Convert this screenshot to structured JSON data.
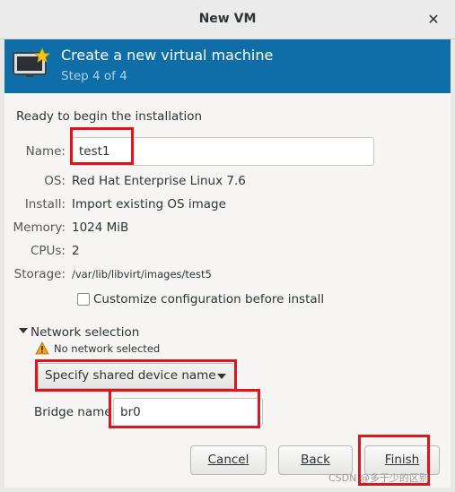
{
  "window": {
    "title": "New VM",
    "close_glyph": "✕"
  },
  "header": {
    "title": "Create a new virtual machine",
    "step": "Step 4 of 4",
    "icon": "monitor-star-icon"
  },
  "ready_text": "Ready to begin the installation",
  "fields": {
    "name": {
      "label": "Name:",
      "value": "test1"
    },
    "os": {
      "label": "OS:",
      "value": "Red Hat Enterprise Linux 7.6"
    },
    "install": {
      "label": "Install:",
      "value": "Import existing OS image"
    },
    "memory": {
      "label": "Memory:",
      "value": "1024 MiB"
    },
    "cpus": {
      "label": "CPUs:",
      "value": "2"
    },
    "storage": {
      "label": "Storage:",
      "value": "/var/lib/libvirt/images/test5"
    }
  },
  "customize_checkbox": {
    "label": "Customize configuration before install",
    "checked": false
  },
  "network": {
    "label": "Network selection",
    "warning": "No network selected",
    "combo_value": "Specify shared device name",
    "bridge_label": "Bridge name:",
    "bridge_value": "br0"
  },
  "buttons": {
    "cancel": "Cancel",
    "back": "Back",
    "finish": "Finish"
  },
  "watermark": "CSDN @多于少的区别",
  "colors": {
    "header_bg": "#0f6ea7",
    "highlight": "#e1131b"
  }
}
